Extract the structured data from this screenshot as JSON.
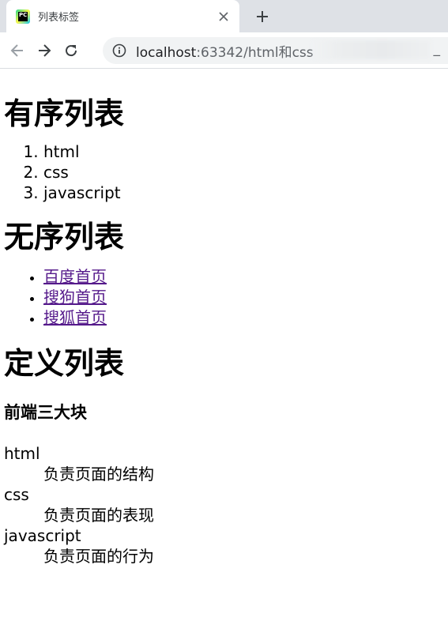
{
  "browser": {
    "tab_title": "列表标签",
    "url_host": "localhost",
    "url_rest": ":63342/html和css",
    "url_tail": "_"
  },
  "page": {
    "ordered_heading": "有序列表",
    "ordered_items": [
      "html",
      "css",
      "javascript"
    ],
    "unordered_heading": "无序列表",
    "unordered_items": [
      "百度首页",
      "搜狗首页",
      "搜狐首页"
    ],
    "definition_heading": "定义列表",
    "definition_title": "前端三大块",
    "definitions": [
      {
        "term": "html",
        "desc": "负责页面的结构"
      },
      {
        "term": "css",
        "desc": "负责页面的表现"
      },
      {
        "term": "javascript",
        "desc": "负责页面的行为"
      }
    ]
  },
  "colors": {
    "link_visited": "#551a8b",
    "tabstrip_bg": "#dee1e6",
    "omnibox_bg": "#f1f3f4"
  }
}
